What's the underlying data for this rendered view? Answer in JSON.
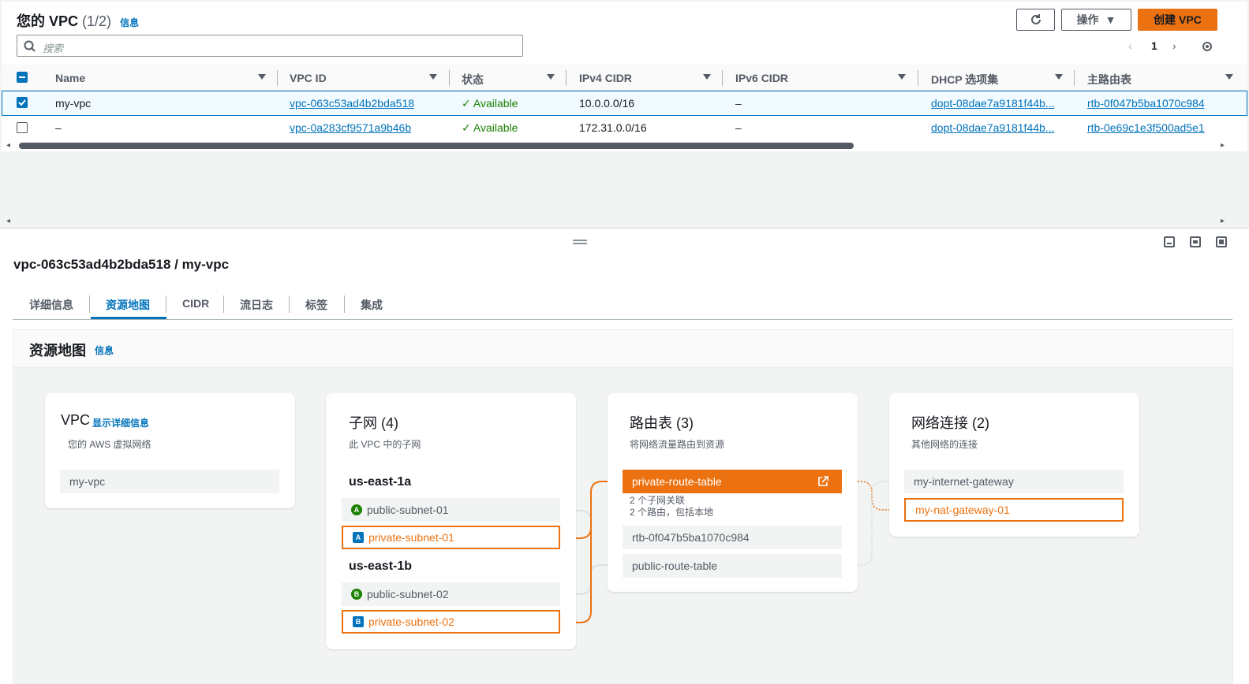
{
  "header": {
    "title": "您的 VPC",
    "count": "(1/2)",
    "info": "信息",
    "actions_label": "操作",
    "create_label": "创建 VPC",
    "search_placeholder": "搜索",
    "page": "1"
  },
  "table": {
    "columns": [
      "Name",
      "VPC ID",
      "状态",
      "IPv4 CIDR",
      "IPv6 CIDR",
      "DHCP 选项集",
      "主路由表"
    ],
    "rows": [
      {
        "selected": true,
        "name": "my-vpc",
        "vpc_id": "vpc-063c53ad4b2bda518",
        "status": "Available",
        "ipv4": "10.0.0.0/16",
        "ipv6": "–",
        "dhcp": "dopt-08dae7a9181f44b...",
        "rtb": "rtb-0f047b5ba1070c984"
      },
      {
        "selected": false,
        "name": "–",
        "vpc_id": "vpc-0a283cf9571a9b46b",
        "status": "Available",
        "ipv4": "172.31.0.0/16",
        "ipv6": "–",
        "dhcp": "dopt-08dae7a9181f44b...",
        "rtb": "rtb-0e69c1e3f500ad5e1"
      }
    ]
  },
  "detail": {
    "title": "vpc-063c53ad4b2bda518 / my-vpc"
  },
  "tabs": [
    "详细信息",
    "资源地图",
    "CIDR",
    "流日志",
    "标签",
    "集成"
  ],
  "map": {
    "title": "资源地图",
    "info": "信息",
    "vpc": {
      "title": "VPC",
      "link": "显示详细信息",
      "sub": "您的 AWS 虚拟网络",
      "item": "my-vpc"
    },
    "subnets": {
      "title": "子网 (4)",
      "sub": "此 VPC 中的子网",
      "az1": "us-east-1a",
      "az2": "us-east-1b",
      "s1": "public-subnet-01",
      "s2": "private-subnet-01",
      "s3": "public-subnet-02",
      "s4": "private-subnet-02",
      "b1": "A",
      "b2": "A",
      "b3": "B",
      "b4": "B"
    },
    "routes": {
      "title": "路由表 (3)",
      "sub": "将网络流量路由到资源",
      "r1": "private-route-table",
      "r1_note1": "2 个子网关联",
      "r1_note2": "2 个路由，包括本地",
      "r2": "rtb-0f047b5ba1070c984",
      "r3": "public-route-table"
    },
    "conns": {
      "title": "网络连接 (2)",
      "sub": "其他网络的连接",
      "c1": "my-internet-gateway",
      "c2": "my-nat-gateway-01"
    }
  }
}
